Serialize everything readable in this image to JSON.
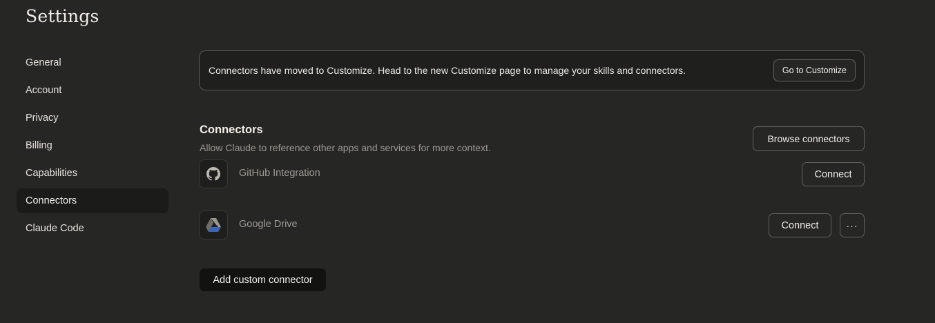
{
  "page": {
    "title": "Settings"
  },
  "sidebar": {
    "items": [
      {
        "label": "General"
      },
      {
        "label": "Account"
      },
      {
        "label": "Privacy"
      },
      {
        "label": "Billing"
      },
      {
        "label": "Capabilities"
      },
      {
        "label": "Connectors",
        "active": true
      },
      {
        "label": "Claude Code"
      }
    ]
  },
  "banner": {
    "text": "Connectors have moved to Customize. Head to the new Customize page to manage your skills and connectors.",
    "button_label": "Go to Customize"
  },
  "connectors": {
    "title": "Connectors",
    "subtitle": "Allow Claude to reference other apps and services for more context.",
    "browse_label": "Browse connectors",
    "items": [
      {
        "name": "GitHub Integration",
        "icon": "github-icon",
        "button_label": "Connect"
      },
      {
        "name": "Google Drive",
        "icon": "google-drive-icon",
        "button_label": "Connect",
        "more_label": "···"
      }
    ],
    "add_custom_label": "Add custom connector"
  },
  "colors": {
    "background": "#262624",
    "sidebar_active": "#1b1b19",
    "border": "#64625d",
    "text_primary": "#f2efe9",
    "text_muted": "#9b9891"
  }
}
